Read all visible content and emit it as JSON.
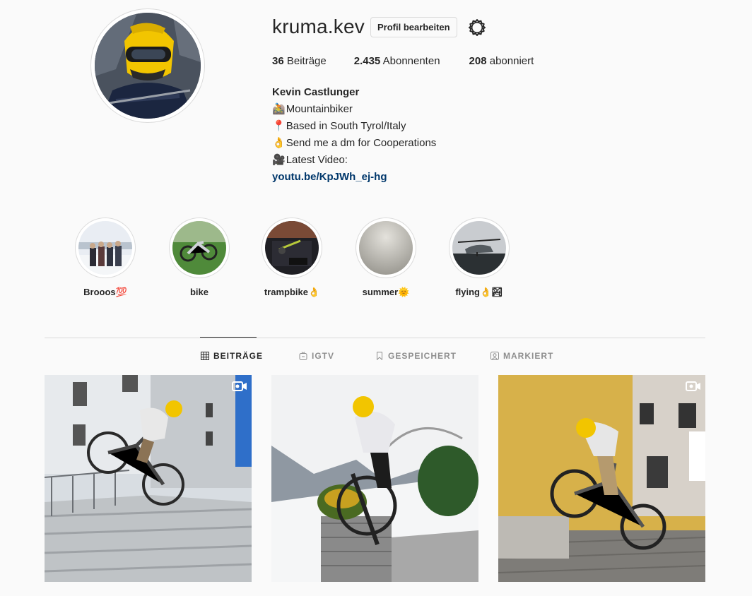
{
  "profile": {
    "username": "kruma.kev",
    "edit_label": "Profil bearbeiten",
    "stats": {
      "posts_count": "36",
      "posts_label": "Beiträge",
      "followers_count": "2.435",
      "followers_label": "Abonnenten",
      "following_count": "208",
      "following_label": "abonniert"
    },
    "bio": {
      "name": "Kevin Castlunger",
      "lines": [
        {
          "emoji": "🚵",
          "text": "Mountainbiker"
        },
        {
          "emoji": "📍",
          "text": "Based in South Tyrol/Italy"
        },
        {
          "emoji": "👌",
          "text": "Send me a dm for Cooperations"
        },
        {
          "emoji": "🎥",
          "text": "Latest Video:"
        }
      ],
      "link": "youtu.be/KpJWh_ej-hg"
    }
  },
  "highlights": [
    {
      "label": "Brooos💯"
    },
    {
      "label": "bike"
    },
    {
      "label": "trampbike👌"
    },
    {
      "label": "summer🌞"
    },
    {
      "label": "flying👌🏞"
    }
  ],
  "tabs": [
    {
      "label": "BEITRÄGE",
      "active": true
    },
    {
      "label": "IGTV",
      "active": false
    },
    {
      "label": "GESPEICHERT",
      "active": false
    },
    {
      "label": "MARKIERT",
      "active": false
    }
  ],
  "posts": [
    {
      "type": "video"
    },
    {
      "type": "image"
    },
    {
      "type": "video"
    }
  ],
  "colors": {
    "link": "#00376b",
    "text": "#262626",
    "muted": "#8e8e8e",
    "border": "#dbdbdb",
    "helmet": "#f2c500"
  }
}
